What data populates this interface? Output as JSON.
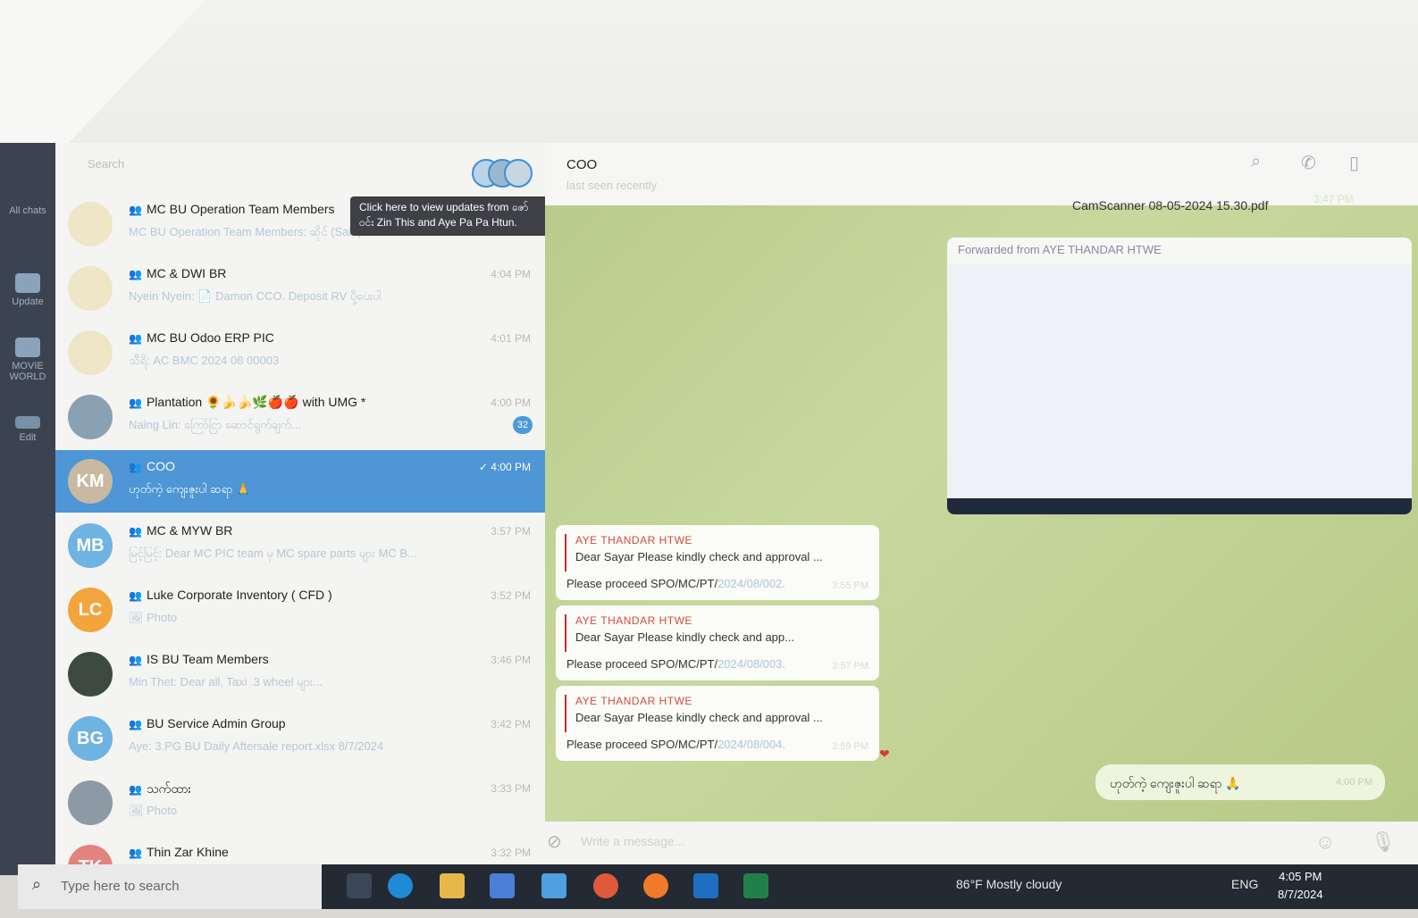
{
  "chat_list": {
    "search_placeholder": "Search",
    "story_tooltip": {
      "line1": "Click here to view updates from ဇော်",
      "line2": "ဝင်း Zin This and Aye Pa Pa Htun."
    },
    "rows": [
      {
        "name": "MC BU Operation Team Members",
        "time": "",
        "preview": "MC BU Operation Team Members: ဆိုင် (Sale)",
        "avatar": "",
        "avatar_color": "#efe6c8",
        "badge": ""
      },
      {
        "name": "MC & DWI BR",
        "time": "4:04 PM",
        "preview": "Nyein Nyein: 📄 Damon CCO. Deposit RV ပို့ပေးပါ",
        "avatar": "",
        "avatar_color": "#efe6c8",
        "badge": ""
      },
      {
        "name": "MC BU Odoo ERP PIC",
        "time": "4:01 PM",
        "preview": "သီရိ: AC BMC 2024 08 00003",
        "avatar": "",
        "avatar_color": "#efe6c8",
        "badge": ""
      },
      {
        "name": "Plantation 🌻🍌🍌🌿🍎🍎 with UMG *",
        "time": "4:00 PM",
        "preview": "Naing Lin: ကြော်ငြာ ဆောင်ရွက်ချက်...",
        "avatar": "",
        "avatar_color": "#8aa0b3",
        "badge": "32"
      },
      {
        "name": "COO",
        "time": "✓ 4:00 PM",
        "preview": "ဟုတ်ကဲ့ ကျေးဇူးပါ ဆရာ 🙏",
        "avatar": "KM",
        "avatar_color": "#c9b9a3",
        "badge": ""
      },
      {
        "name": "MC & MYW BR",
        "time": "3:57 PM",
        "preview": "မြင့်မြင့်: Dear MC PIC team မှ MC spare parts များ MC B...",
        "avatar": "MB",
        "avatar_color": "#6fb3e3",
        "badge": ""
      },
      {
        "name": "Luke Corporate Inventory ( CFD )",
        "time": "3:52 PM",
        "preview": "🖼 Photo",
        "avatar": "LC",
        "avatar_color": "#f2a43d",
        "badge": ""
      },
      {
        "name": "IS BU Team Members",
        "time": "3:46 PM",
        "preview": "Min Thet: Dear all, Taxi .3 wheel များ...",
        "avatar": "",
        "avatar_color": "#3d4a3f",
        "badge": ""
      },
      {
        "name": "BU Service Admin Group",
        "time": "3:42 PM",
        "preview": "Aye: 3.PG BU Daily Aftersale report.xlsx 8/7/2024",
        "avatar": "BG",
        "avatar_color": "#6fb3e3",
        "badge": ""
      },
      {
        "name": "သက်ထား",
        "time": "3:33 PM",
        "preview": "🖼 Photo",
        "avatar": "",
        "avatar_color": "#8d9aa6",
        "badge": ""
      },
      {
        "name": "Thin Zar Khine",
        "time": "3:32 PM",
        "preview": "",
        "avatar": "TK",
        "avatar_color": "#e4827f",
        "badge": ""
      }
    ]
  },
  "rail": [
    {
      "label": "All chats"
    },
    {
      "label": "Update"
    },
    {
      "label": "MOVIE WORLD"
    },
    {
      "label": "Edit"
    }
  ],
  "chat": {
    "title": "COO",
    "status": "last seen recently",
    "pdf_name": "CamScanner 08-05-2024 15.30.pdf",
    "pdf_time": "3:47 PM",
    "forwarded_label": "Forwarded from AYE THANDAR HTWE",
    "messages": [
      {
        "sender": "AYE THANDAR HTWE",
        "quote": "Dear Sayar Please kindly check and approval ...",
        "text": "Please proceed SPO/MC/PT/",
        "link": "2024/08/002.",
        "time": "3:55 PM"
      },
      {
        "sender": "AYE THANDAR HTWE",
        "quote": "Dear Sayar Please kindly check and app...",
        "text": "Please proceed SPO/MC/PT/",
        "link": "2024/08/003.",
        "time": "3:57 PM"
      },
      {
        "sender": "AYE THANDAR HTWE",
        "quote": "Dear Sayar Please kindly check and approval ...",
        "text": "Please proceed SPO/MC/PT/",
        "link": "2024/08/004.",
        "time": "3:59 PM"
      }
    ],
    "outgoing": {
      "text": "ဟုတ်ကဲ့ ကျေးဇူးပါ ဆရာ 🙏",
      "time": "4:00 PM"
    },
    "composer_placeholder": "Write a message..."
  },
  "taskbar": {
    "search_placeholder": "Type here to search",
    "weather": "86°F Mostly cloudy",
    "lang": "ENG",
    "time": "4:05 PM",
    "date": "8/7/2024"
  }
}
